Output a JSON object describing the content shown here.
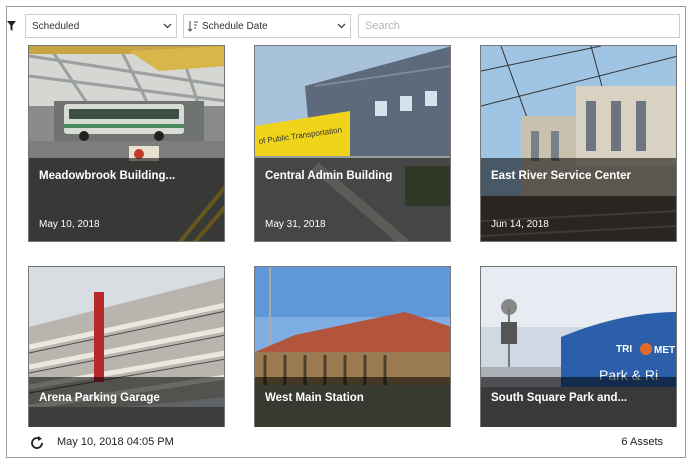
{
  "toolbar": {
    "filter_value": "Scheduled",
    "sort_value": "Schedule Date",
    "search_placeholder": "Search"
  },
  "cards": [
    {
      "title": "Meadowbrook Building...",
      "date": "May 10, 2018"
    },
    {
      "title": "Central Admin Building",
      "date": "May 31, 2018"
    },
    {
      "title": "East River Service Center",
      "date": "Jun 14, 2018"
    },
    {
      "title": "Arena Parking Garage",
      "date": ""
    },
    {
      "title": "West Main Station",
      "date": ""
    },
    {
      "title": "South Square Park and...",
      "date": ""
    }
  ],
  "photo_text": {
    "card2_sign": "of Public Transportation",
    "card6_brand": "TRI",
    "card6_brand_end": "MET",
    "card6_sign": "Park & Ri"
  },
  "footer": {
    "timestamp": "May 10, 2018 04:05 PM",
    "asset_count": "6 Assets"
  },
  "icons": [
    "filter-icon",
    "sort-icon",
    "chevron-down-icon",
    "refresh-icon"
  ]
}
